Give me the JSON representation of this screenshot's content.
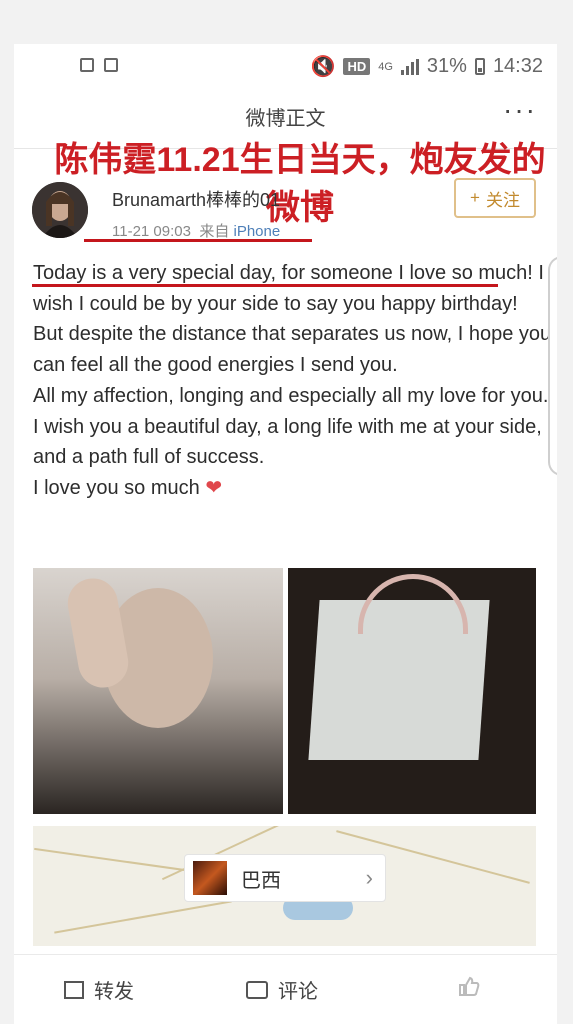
{
  "status": {
    "hd": "HD",
    "network": "4G",
    "battery": "31%",
    "time": "14:32"
  },
  "header": {
    "title": "微博正文",
    "more": "···"
  },
  "caption": "陈伟霆11.21生日当天，炮友发的微博",
  "user": {
    "name": "Brunamarth棒棒的01",
    "time": "11-21 09:03",
    "from_prefix": "来自",
    "source": "iPhone"
  },
  "follow": {
    "plus": "+",
    "label": "关注"
  },
  "post": {
    "p1": "Today is a very special day, for someone I love so much! I wish I could be by your side to say you happy birthday!",
    "p2": "But despite the distance that separates us now, I hope you can feel all the good energies I send you.",
    "p3": "All my affection, longing and especially all my love for you.",
    "p4": "I wish you a beautiful day, a long life with me at your side, and a path full of success.",
    "p5": "I love you so much",
    "heart": "❤"
  },
  "location": {
    "name": "巴西",
    "chevron": "›"
  },
  "bottom": {
    "repost": "转发",
    "comment": "评论"
  }
}
